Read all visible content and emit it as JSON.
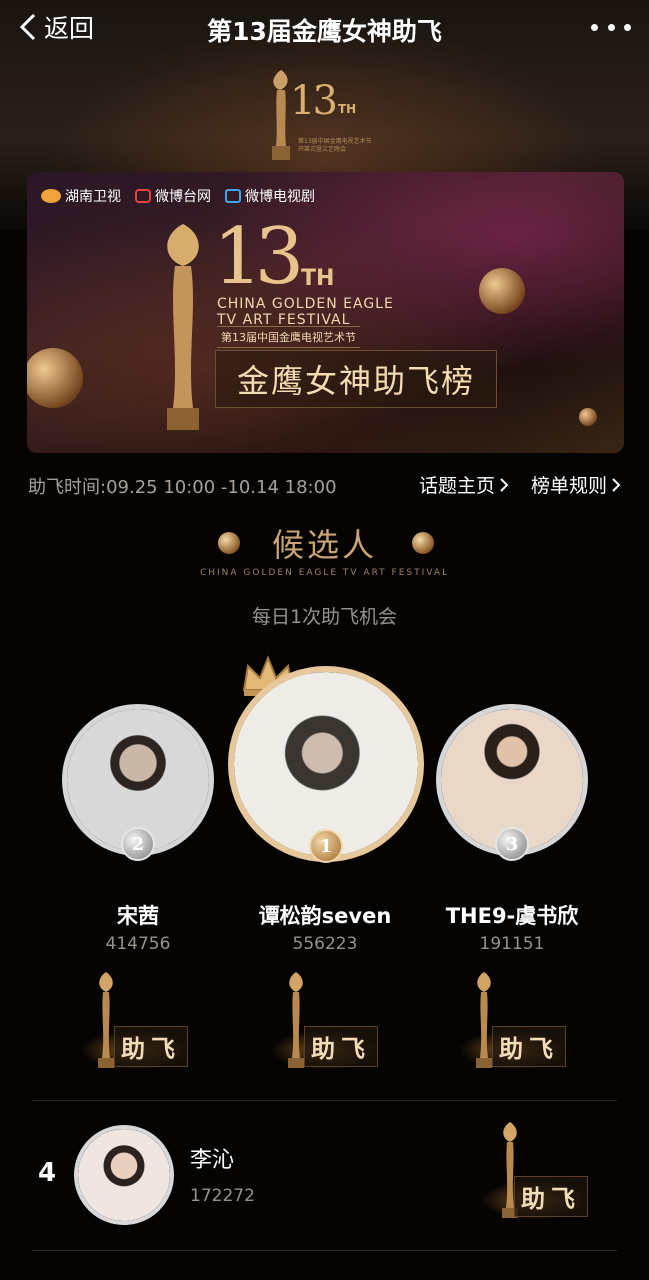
{
  "header": {
    "back_label": "返回",
    "title": "第13届金鹰女神助飞"
  },
  "top_art": {
    "number": "13",
    "suffix": "TH",
    "subtitle": "第13届中国金鹰电视艺术节 开幕式暨文艺晚会"
  },
  "banner": {
    "logos": [
      "湖南卫视",
      "微博台网",
      "微博电视剧"
    ],
    "number": "13",
    "suffix": "TH",
    "english": "CHINA GOLDEN EAGLE TV ART FESTIVAL",
    "chinese": "第13届中国金鹰电视艺术节",
    "board_title": "金鹰女神助飞榜"
  },
  "info": {
    "time": "助飞时间:09.25 10:00 -10.14 18:00",
    "topic_link": "话题主页",
    "rules_link": "榜单规则"
  },
  "section": {
    "title": "候选人",
    "english": "CHINA GOLDEN EAGLE TV ART FESTIVAL",
    "subtitle": "每日1次助飞机会"
  },
  "podium": [
    {
      "rank": "1",
      "name": "谭松韵seven",
      "score": "556223"
    },
    {
      "rank": "2",
      "name": "宋茜",
      "score": "414756"
    },
    {
      "rank": "3",
      "name": "THE9-虞书欣",
      "score": "191151"
    }
  ],
  "boost_label": "助飞",
  "list": [
    {
      "rank": "4",
      "name": "李沁",
      "score": "172272"
    }
  ],
  "colors": {
    "gold": "#e7c79c",
    "silver": "#d6d6d6",
    "background": "#050403"
  }
}
